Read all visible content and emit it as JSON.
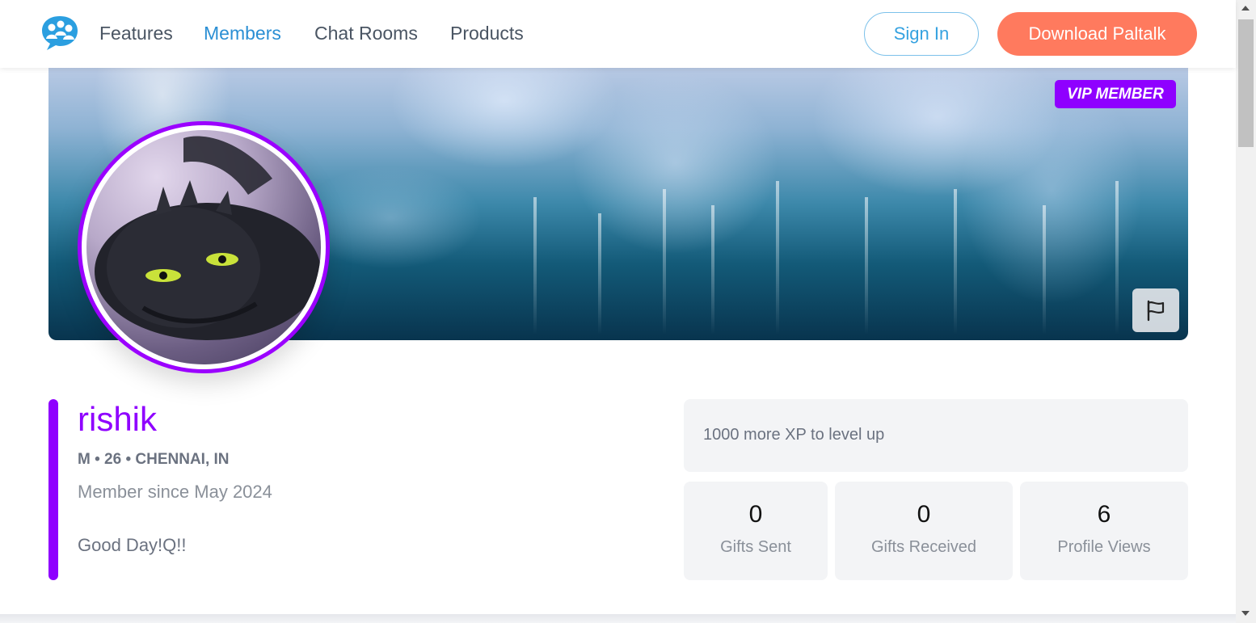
{
  "nav": {
    "links": [
      "Features",
      "Members",
      "Chat Rooms",
      "Products"
    ],
    "active": "Members",
    "sign_in": "Sign In",
    "download": "Download Paltalk"
  },
  "banner": {
    "badge": "VIP MEMBER",
    "report_icon": "flag-icon"
  },
  "profile": {
    "username": "rishik",
    "meta": "M • 26 • CHENNAI, IN",
    "member_since": "Member since May 2024",
    "status": "Good Day!Q!!"
  },
  "xp": {
    "text": "1000 more XP to level up"
  },
  "stats": [
    {
      "value": "0",
      "label": "Gifts Sent"
    },
    {
      "value": "0",
      "label": "Gifts Received"
    },
    {
      "value": "6",
      "label": "Profile Views"
    }
  ],
  "colors": {
    "accent": "#8f00ff",
    "link_active": "#2b8fd4",
    "download_btn": "#ff7a5e"
  }
}
